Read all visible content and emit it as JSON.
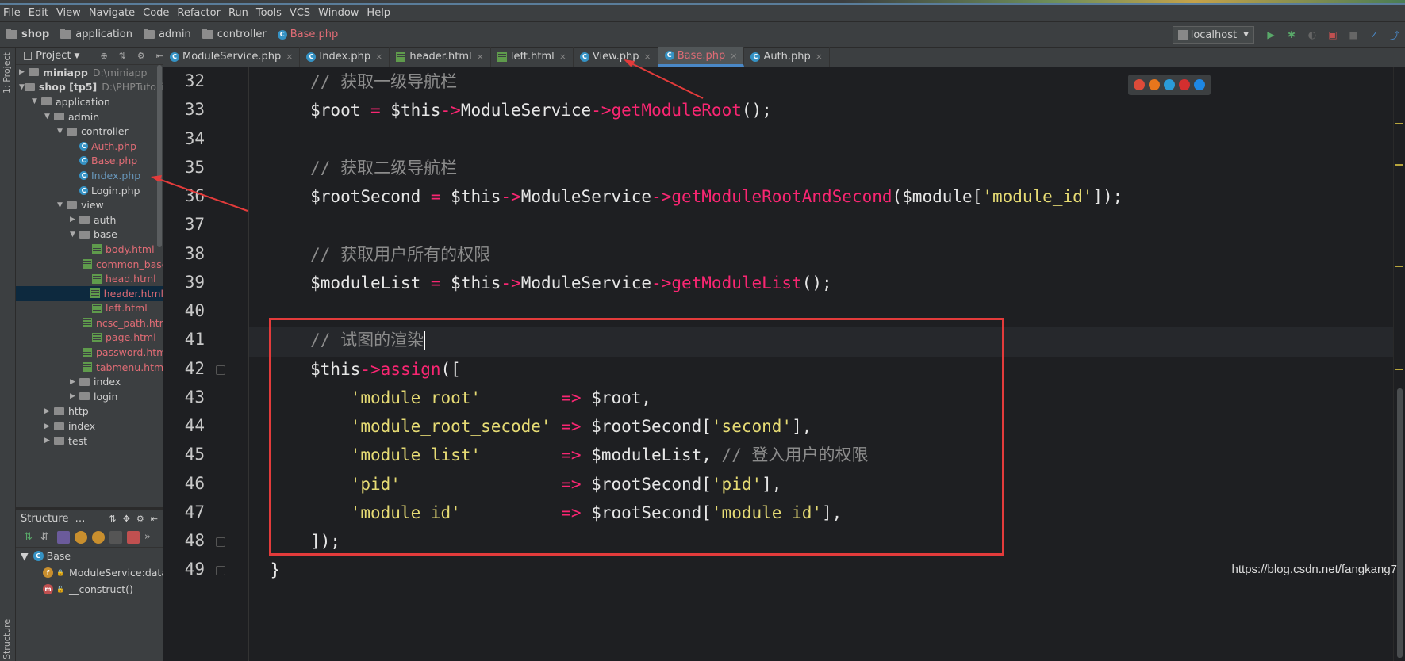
{
  "menu": [
    "File",
    "Edit",
    "View",
    "Navigate",
    "Code",
    "Refactor",
    "Run",
    "Tools",
    "VCS",
    "Window",
    "Help"
  ],
  "breadcrumb": [
    "shop",
    "application",
    "admin",
    "controller",
    "Base.php"
  ],
  "run_config": "localhost",
  "project_panel": {
    "title": "Project",
    "tree": [
      {
        "label": "miniapp",
        "meta": "D:\\miniapp",
        "kind": "folder",
        "bold": true,
        "indent": 0,
        "arrow": "▶"
      },
      {
        "label": "shop [tp5]",
        "meta": "D:\\PHPTutorial\\W",
        "kind": "folder",
        "bold": true,
        "indent": 0,
        "arrow": "▼"
      },
      {
        "label": "application",
        "kind": "folder",
        "indent": 1,
        "arrow": "▼"
      },
      {
        "label": "admin",
        "kind": "folder",
        "indent": 2,
        "arrow": "▼"
      },
      {
        "label": "controller",
        "kind": "folder",
        "indent": 3,
        "arrow": "▼"
      },
      {
        "label": "Auth.php",
        "kind": "php",
        "indent": 4,
        "color": "red"
      },
      {
        "label": "Base.php",
        "kind": "php",
        "indent": 4,
        "color": "red"
      },
      {
        "label": "Index.php",
        "kind": "php",
        "indent": 4,
        "color": "blue"
      },
      {
        "label": "Login.php",
        "kind": "php",
        "indent": 4,
        "color": "plain"
      },
      {
        "label": "view",
        "kind": "folder",
        "indent": 3,
        "arrow": "▼"
      },
      {
        "label": "auth",
        "kind": "folder",
        "indent": 4,
        "arrow": "▶"
      },
      {
        "label": "base",
        "kind": "folder",
        "indent": 4,
        "arrow": "▼"
      },
      {
        "label": "body.html",
        "kind": "html",
        "indent": 5
      },
      {
        "label": "common_base",
        "kind": "html",
        "indent": 5
      },
      {
        "label": "head.html",
        "kind": "html",
        "indent": 5
      },
      {
        "label": "header.html",
        "kind": "html",
        "indent": 5,
        "selected": true
      },
      {
        "label": "left.html",
        "kind": "html",
        "indent": 5
      },
      {
        "label": "ncsc_path.htm",
        "kind": "html",
        "indent": 5
      },
      {
        "label": "page.html",
        "kind": "html",
        "indent": 5
      },
      {
        "label": "password.htm",
        "kind": "html",
        "indent": 5
      },
      {
        "label": "tabmenu.html",
        "kind": "html",
        "indent": 5
      },
      {
        "label": "index",
        "kind": "folder",
        "indent": 4,
        "arrow": "▶"
      },
      {
        "label": "login",
        "kind": "folder",
        "indent": 4,
        "arrow": "▶"
      },
      {
        "label": "http",
        "kind": "folder",
        "indent": 2,
        "arrow": "▶"
      },
      {
        "label": "index",
        "kind": "folder",
        "indent": 2,
        "arrow": "▶"
      },
      {
        "label": "test",
        "kind": "folder",
        "indent": 2,
        "arrow": "▶"
      }
    ]
  },
  "structure_panel": {
    "title": "Structure",
    "items": [
      {
        "label": "Base",
        "badge": "C",
        "badge_color": "#3592c4",
        "indent": 0
      },
      {
        "label": "ModuleService:data\\se",
        "badge": "f",
        "badge_color": "#c98f2e",
        "indent": 1
      },
      {
        "label": "__construct()",
        "badge": "m",
        "badge_color": "#c05050",
        "indent": 1
      }
    ]
  },
  "tabs": [
    {
      "label": "ModuleService.php",
      "type": "php",
      "active": false
    },
    {
      "label": "Index.php",
      "type": "php",
      "active": false
    },
    {
      "label": "header.html",
      "type": "html",
      "active": false
    },
    {
      "label": "left.html",
      "type": "html",
      "active": false
    },
    {
      "label": "View.php",
      "type": "php",
      "active": false
    },
    {
      "label": "Base.php",
      "type": "php",
      "active": true
    },
    {
      "label": "Auth.php",
      "type": "php",
      "active": false
    }
  ],
  "editor": {
    "lines": [
      {
        "no": "32",
        "tokens": [
          [
            "c-comment",
            "        // 获取一级导航栏"
          ]
        ]
      },
      {
        "no": "33",
        "tokens": [
          [
            "c-var",
            "        $root "
          ],
          [
            "c-op",
            "="
          ],
          [
            "c-var",
            " $this"
          ],
          [
            "c-op",
            "->"
          ],
          [
            "c-var",
            "ModuleService"
          ],
          [
            "c-op",
            "->"
          ],
          [
            "c-func",
            "getModuleRoot"
          ],
          [
            "c-punc",
            "();"
          ]
        ]
      },
      {
        "no": "34",
        "tokens": []
      },
      {
        "no": "35",
        "tokens": [
          [
            "c-comment",
            "        // 获取二级导航栏"
          ]
        ]
      },
      {
        "no": "36",
        "tokens": [
          [
            "c-var",
            "        $rootSecond "
          ],
          [
            "c-op",
            "="
          ],
          [
            "c-var",
            " $this"
          ],
          [
            "c-op",
            "->"
          ],
          [
            "c-var",
            "ModuleService"
          ],
          [
            "c-op",
            "->"
          ],
          [
            "c-func",
            "getModuleRootAndSecond"
          ],
          [
            "c-punc",
            "($module["
          ],
          [
            "c-str",
            "'module_id'"
          ],
          [
            "c-punc",
            "]);"
          ]
        ]
      },
      {
        "no": "37",
        "tokens": []
      },
      {
        "no": "38",
        "tokens": [
          [
            "c-comment",
            "        // 获取用户所有的权限"
          ]
        ]
      },
      {
        "no": "39",
        "tokens": [
          [
            "c-var",
            "        $moduleList "
          ],
          [
            "c-op",
            "="
          ],
          [
            "c-var",
            " $this"
          ],
          [
            "c-op",
            "->"
          ],
          [
            "c-var",
            "ModuleService"
          ],
          [
            "c-op",
            "->"
          ],
          [
            "c-func",
            "getModuleList"
          ],
          [
            "c-punc",
            "();"
          ]
        ]
      },
      {
        "no": "40",
        "tokens": []
      },
      {
        "no": "41",
        "tokens": [
          [
            "c-comment",
            "        // 试图的渲染"
          ]
        ],
        "current": true
      },
      {
        "no": "42",
        "tokens": [
          [
            "c-var",
            "        $this"
          ],
          [
            "c-op",
            "->"
          ],
          [
            "c-func",
            "assign"
          ],
          [
            "c-punc",
            "(["
          ]
        ]
      },
      {
        "no": "43",
        "tokens": [
          [
            "c-str",
            "            'module_root'"
          ],
          [
            "c-var",
            "        "
          ],
          [
            "c-op",
            "=>"
          ],
          [
            "c-var",
            " $root,"
          ]
        ]
      },
      {
        "no": "44",
        "tokens": [
          [
            "c-str",
            "            'module_root_secode'"
          ],
          [
            "c-var",
            " "
          ],
          [
            "c-op",
            "=>"
          ],
          [
            "c-var",
            " $rootSecond["
          ],
          [
            "c-str",
            "'second'"
          ],
          [
            "c-punc",
            "],"
          ]
        ]
      },
      {
        "no": "45",
        "tokens": [
          [
            "c-str",
            "            'module_list'"
          ],
          [
            "c-var",
            "        "
          ],
          [
            "c-op",
            "=>"
          ],
          [
            "c-var",
            " $moduleList, "
          ],
          [
            "c-comment",
            "// 登入用户的权限"
          ]
        ]
      },
      {
        "no": "46",
        "tokens": [
          [
            "c-str",
            "            'pid'"
          ],
          [
            "c-var",
            "                "
          ],
          [
            "c-op",
            "=>"
          ],
          [
            "c-var",
            " $rootSecond["
          ],
          [
            "c-str",
            "'pid'"
          ],
          [
            "c-punc",
            "],"
          ]
        ]
      },
      {
        "no": "47",
        "tokens": [
          [
            "c-str",
            "            'module_id'"
          ],
          [
            "c-var",
            "          "
          ],
          [
            "c-op",
            "=>"
          ],
          [
            "c-var",
            " $rootSecond["
          ],
          [
            "c-str",
            "'module_id'"
          ],
          [
            "c-punc",
            "],"
          ]
        ]
      },
      {
        "no": "48",
        "tokens": [
          [
            "c-punc",
            "        ]);"
          ]
        ]
      },
      {
        "no": "49",
        "tokens": [
          [
            "c-punc",
            "    }"
          ]
        ]
      }
    ]
  },
  "browser_icons": [
    "chrome-icon",
    "firefox-icon",
    "safari-icon",
    "opera-icon",
    "ie-icon"
  ],
  "watermark": "https://blog.csdn.net/fangkang7",
  "colors": {
    "annotation_red": "#e33b3b",
    "active_tab_underline": "#4a88c7"
  }
}
